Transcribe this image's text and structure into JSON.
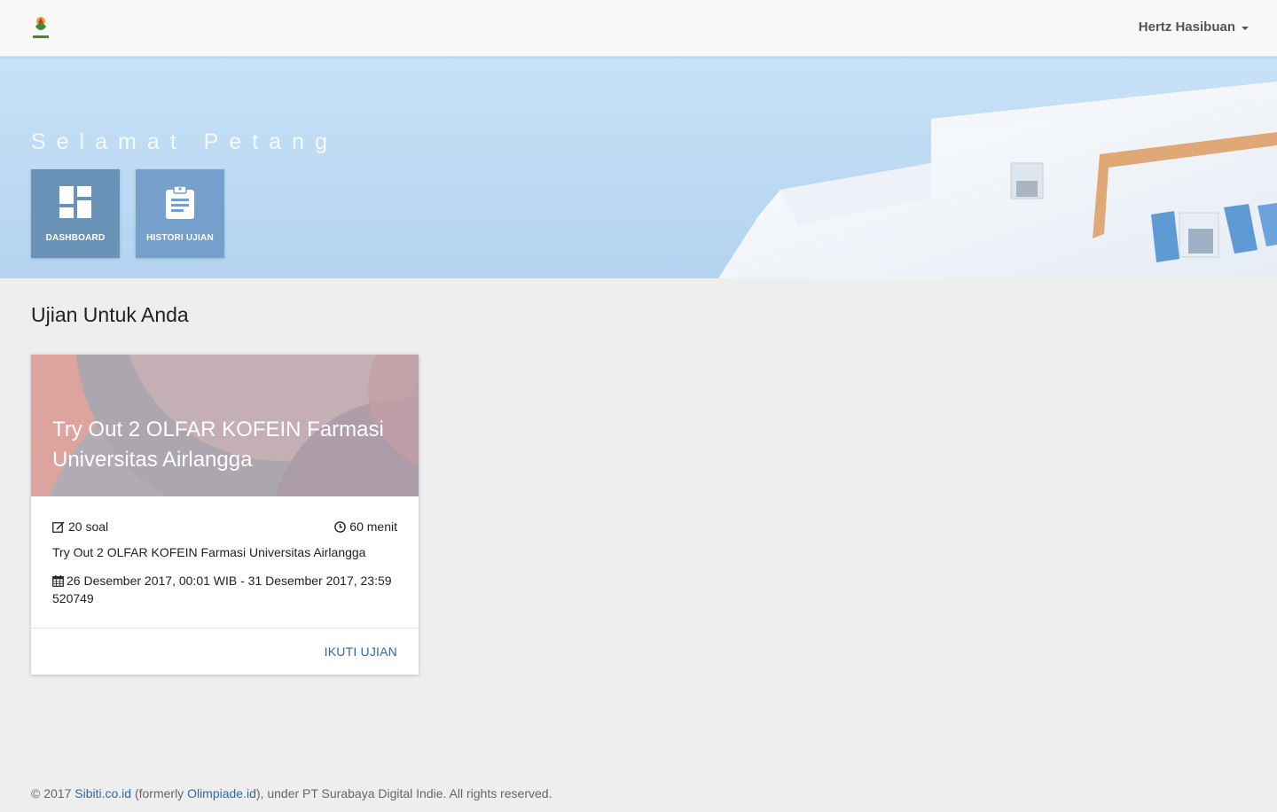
{
  "navbar": {
    "logo_icon": "sibiti-logo-icon",
    "user_name": "Hertz Hasibuan"
  },
  "hero": {
    "greeting": "Selamat Petang",
    "tiles": [
      {
        "label": "DASHBOARD",
        "icon": "dashboard-icon",
        "color": "#6b93b8"
      },
      {
        "label": "HISTORI UJIAN",
        "icon": "clipboard-icon",
        "color": "#76a0cb"
      }
    ]
  },
  "main": {
    "section_title": "Ujian Untuk Anda",
    "cards": [
      {
        "title": "Try Out 2 OLFAR KOFEIN Farmasi Universitas Airlangga",
        "questions": "20 soal",
        "duration": "60 menit",
        "description": "Try Out 2 OLFAR KOFEIN Farmasi Universitas Airlangga",
        "schedule": "26 Desember 2017, 00:01 WIB - 31 Desember 2017, 23:59",
        "code": "520749",
        "action_label": "IKUTI UJIAN"
      }
    ]
  },
  "footer": {
    "prefix": "© 2017 ",
    "link1": "Sibiti.co.id",
    "middle": " (formerly ",
    "link2": "Olimpiade.id",
    "suffix": "), under PT Surabaya Digital Indie. All rights reserved."
  },
  "colors": {
    "accent": "#2f6aa8",
    "tile_dashboard": "#6b93b8",
    "tile_history": "#76a0cb",
    "background": "#eeeeee"
  }
}
